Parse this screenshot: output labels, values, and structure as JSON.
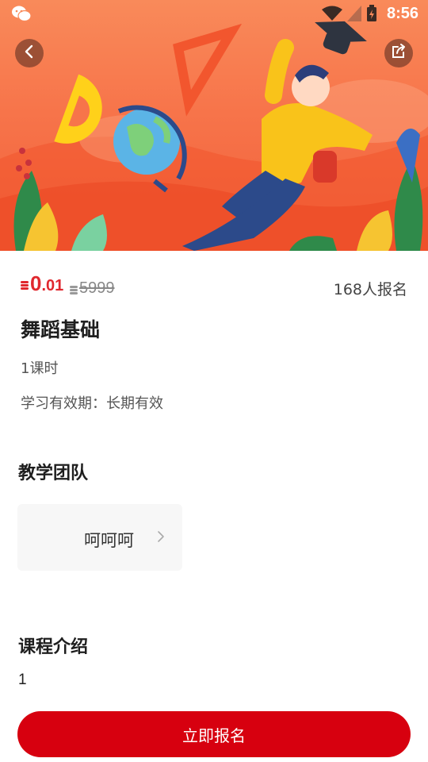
{
  "status_bar": {
    "time": "8:56",
    "icons": [
      "wechat-icon",
      "wifi-icon",
      "signal-icon",
      "battery-charging-icon"
    ]
  },
  "header": {
    "back_icon": "chevron-left-icon",
    "share_icon": "share-icon"
  },
  "course": {
    "price_integer": "0",
    "price_decimal": ".01",
    "original_price": "5999",
    "enroll_count": "168人报名",
    "title": "舞蹈基础",
    "lessons": "1课时",
    "validity": "学习有效期：长期有效"
  },
  "team": {
    "section_title": "教学团队",
    "teachers": [
      {
        "name": "呵呵呵"
      }
    ]
  },
  "intro": {
    "section_title": "课程介绍",
    "content": "1"
  },
  "footer": {
    "cta_label": "立即报名"
  },
  "colors": {
    "accent_red": "#d7000f",
    "price_red": "#e0282e",
    "hero_orange": "#f7744a"
  }
}
